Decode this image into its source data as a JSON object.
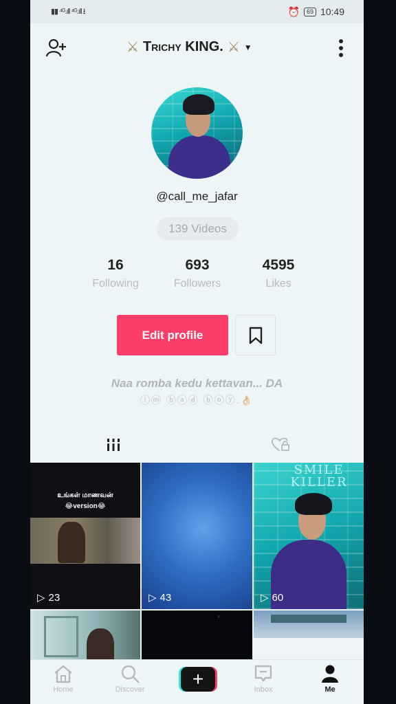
{
  "status_bar": {
    "left_text": "4G",
    "battery": "69",
    "time": "10:49"
  },
  "header": {
    "title": "Trichy KING.",
    "add_user_icon": "person-plus-icon",
    "menu_icon": "more-vertical-icon",
    "title_decoration": "crossed-swords"
  },
  "profile": {
    "username": "@call_me_jafar",
    "videos_label": "139 Videos",
    "stats": [
      {
        "value": "16",
        "label": "Following"
      },
      {
        "value": "693",
        "label": "Followers"
      },
      {
        "value": "4595",
        "label": "Likes"
      }
    ],
    "edit_label": "Edit profile",
    "bio_line1": "Naa romba kedu kettavan... DA",
    "bio_line2": "ⓘⓜ ⓑⓐⓓ ⓑⓞⓨ.👌🏻"
  },
  "tabs": [
    {
      "icon": "grid-icon",
      "active": true
    },
    {
      "icon": "liked-lock-icon",
      "active": false
    }
  ],
  "videos": [
    {
      "views": "23",
      "caption1": "உங்கள் மாணவன்",
      "caption2": "😂version😂"
    },
    {
      "views": "43"
    },
    {
      "views": "60",
      "sign": "SMILE KILLER"
    },
    {
      "views": ""
    },
    {
      "views": ""
    },
    {
      "views": ""
    }
  ],
  "nav": [
    {
      "label": "Home",
      "icon": "home-icon"
    },
    {
      "label": "Discover",
      "icon": "search-icon"
    },
    {
      "label": "+",
      "icon": "create-icon"
    },
    {
      "label": "Inbox",
      "icon": "inbox-icon"
    },
    {
      "label": "Me",
      "icon": "profile-icon"
    }
  ],
  "colors": {
    "accent": "#fb3e6a",
    "cyan": "#27e8e4",
    "background": "#eef5f6"
  }
}
